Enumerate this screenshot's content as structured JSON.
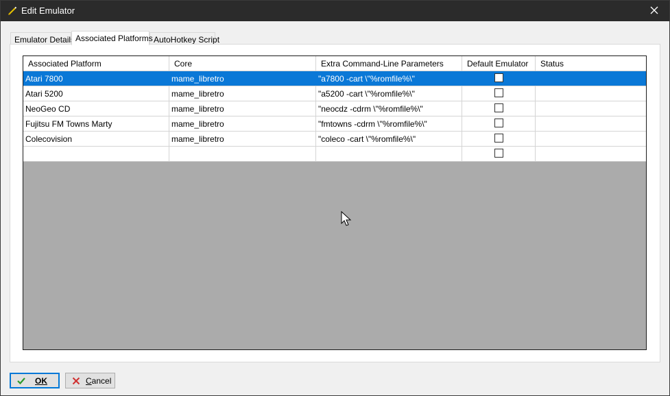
{
  "window": {
    "title": "Edit Emulator",
    "icons": {
      "app": "pencil-icon",
      "close": "close-icon"
    }
  },
  "tabs": [
    {
      "label": "Emulator Details",
      "active": false
    },
    {
      "label": "Associated Platforms",
      "active": true
    },
    {
      "label": "AutoHotkey Script",
      "active": false
    }
  ],
  "grid": {
    "columns": [
      "Associated Platform",
      "Core",
      "Extra Command-Line Parameters",
      "Default Emulator",
      "Status"
    ],
    "rows": [
      {
        "platform": "Atari 7800",
        "core": "mame_libretro",
        "params": "\"a7800  -cart \\\"%romfile%\\\"",
        "default": false,
        "status": "",
        "selected": true
      },
      {
        "platform": "Atari 5200",
        "core": "mame_libretro",
        "params": "\"a5200  -cart \\\"%romfile%\\\"",
        "default": false,
        "status": "",
        "selected": false
      },
      {
        "platform": "NeoGeo CD",
        "core": "mame_libretro",
        "params": "\"neocdz -cdrm \\\"%romfile%\\\"",
        "default": false,
        "status": "",
        "selected": false
      },
      {
        "platform": "Fujitsu FM Towns Marty",
        "core": "mame_libretro",
        "params": "\"fmtowns -cdrm \\\"%romfile%\\\"",
        "default": false,
        "status": "",
        "selected": false
      },
      {
        "platform": "Colecovision",
        "core": "mame_libretro",
        "params": "\"coleco -cart \\\"%romfile%\\\"",
        "default": false,
        "status": "",
        "selected": false
      },
      {
        "platform": "",
        "core": "",
        "params": "",
        "default": false,
        "status": "",
        "selected": false
      }
    ],
    "colors": {
      "selected_row": "#0a78d7",
      "empty_area": "#ababab"
    }
  },
  "buttons": {
    "ok": {
      "label": "OK",
      "icon": "checkmark-icon"
    },
    "cancel": {
      "label": "Cancel",
      "icon": "x-icon"
    }
  }
}
